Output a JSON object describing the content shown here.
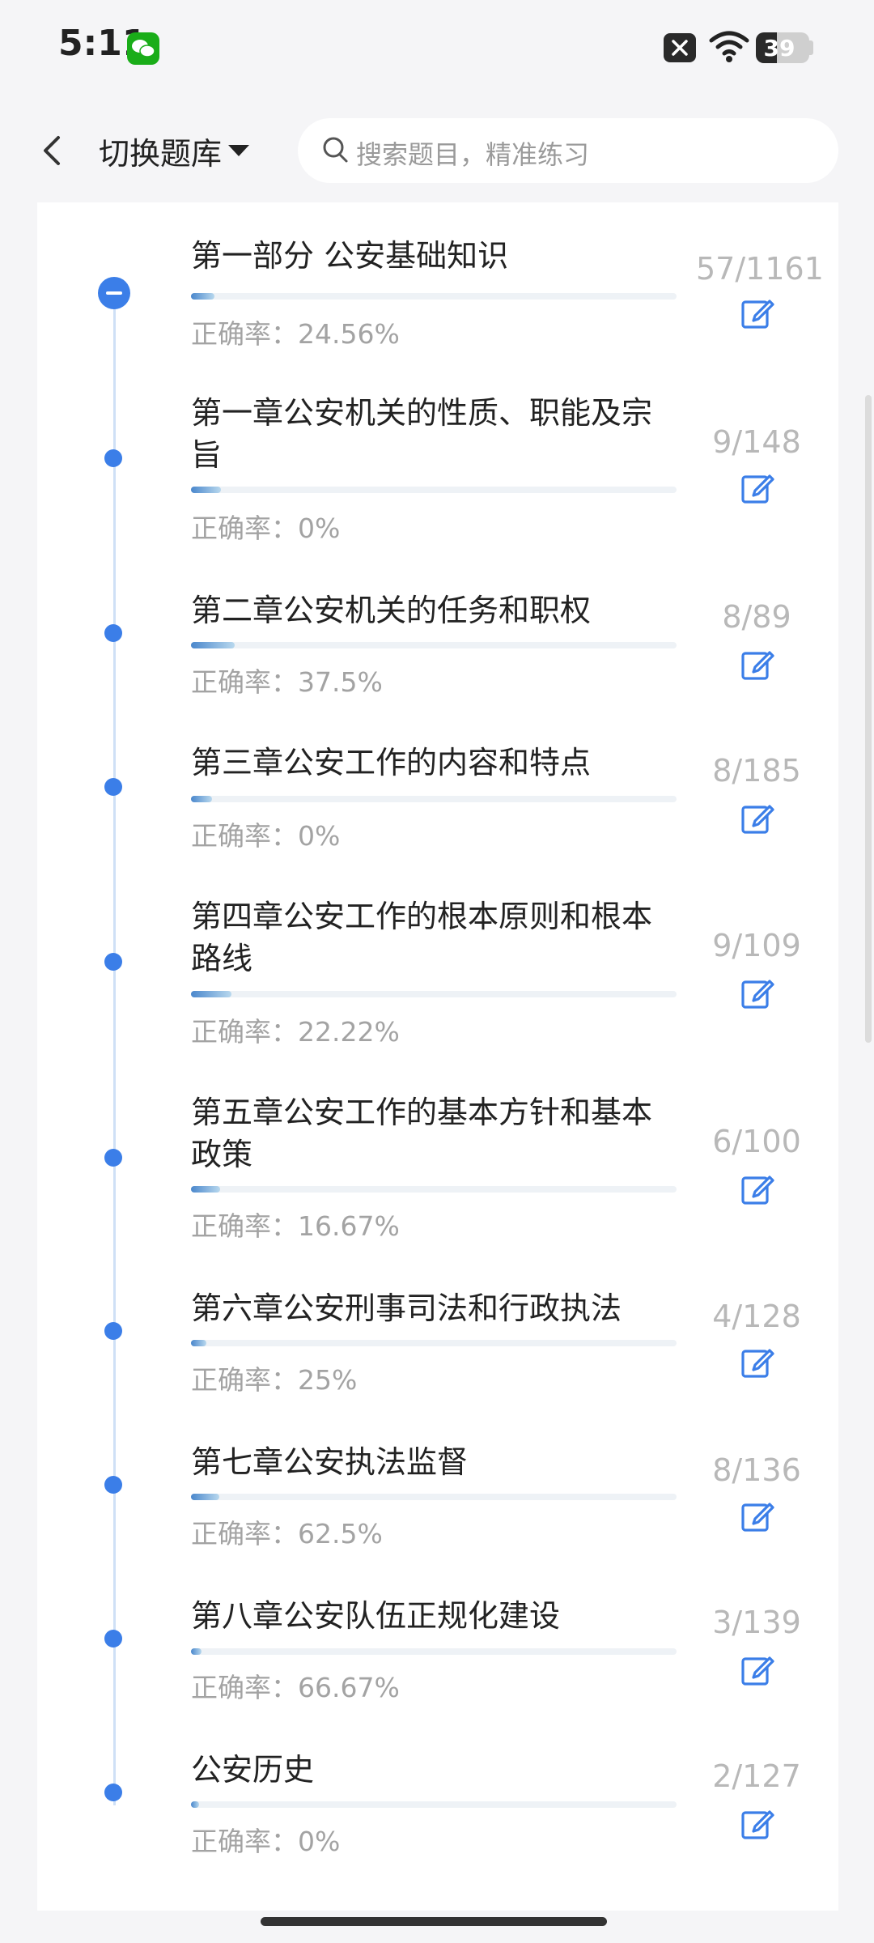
{
  "status_bar": {
    "time": "5:11",
    "battery_level": "39",
    "icons": [
      "wechat-icon",
      "x-notification-icon",
      "wifi-icon",
      "battery-icon"
    ]
  },
  "header": {
    "switch_label": "切换题库",
    "search_placeholder": "搜索题目，精准练习",
    "icons": [
      "back-arrow-icon",
      "caret-down-icon",
      "search-icon"
    ]
  },
  "colors": {
    "accent": "#3b7ee8",
    "muted_text": "#a3a3a3",
    "bar_track": "#eef2f6"
  },
  "accuracy_prefix": "正确率：",
  "chapters": [
    {
      "title": "第一部分 公安基础知识",
      "accuracy": "24.56%",
      "count": "57/1161",
      "progress": 0.049
    },
    {
      "title": "第一章公安机关的性质、职能及宗旨",
      "accuracy": "0%",
      "count": "9/148",
      "progress": 0.061
    },
    {
      "title": "第二章公安机关的任务和职权",
      "accuracy": "37.5%",
      "count": "8/89",
      "progress": 0.09
    },
    {
      "title": "第三章公安工作的内容和特点",
      "accuracy": "0%",
      "count": "8/185",
      "progress": 0.043
    },
    {
      "title": "第四章公安工作的根本原则和根本路线",
      "accuracy": "22.22%",
      "count": "9/109",
      "progress": 0.083
    },
    {
      "title": "第五章公安工作的基本方针和基本政策",
      "accuracy": "16.67%",
      "count": "6/100",
      "progress": 0.06
    },
    {
      "title": "第六章公安刑事司法和行政执法",
      "accuracy": "25%",
      "count": "4/128",
      "progress": 0.031
    },
    {
      "title": "第七章公安执法监督",
      "accuracy": "62.5%",
      "count": "8/136",
      "progress": 0.059
    },
    {
      "title": "第八章公安队伍正规化建设",
      "accuracy": "66.67%",
      "count": "3/139",
      "progress": 0.022
    },
    {
      "title": "公安历史",
      "accuracy": "0%",
      "count": "2/127",
      "progress": 0.016
    }
  ]
}
